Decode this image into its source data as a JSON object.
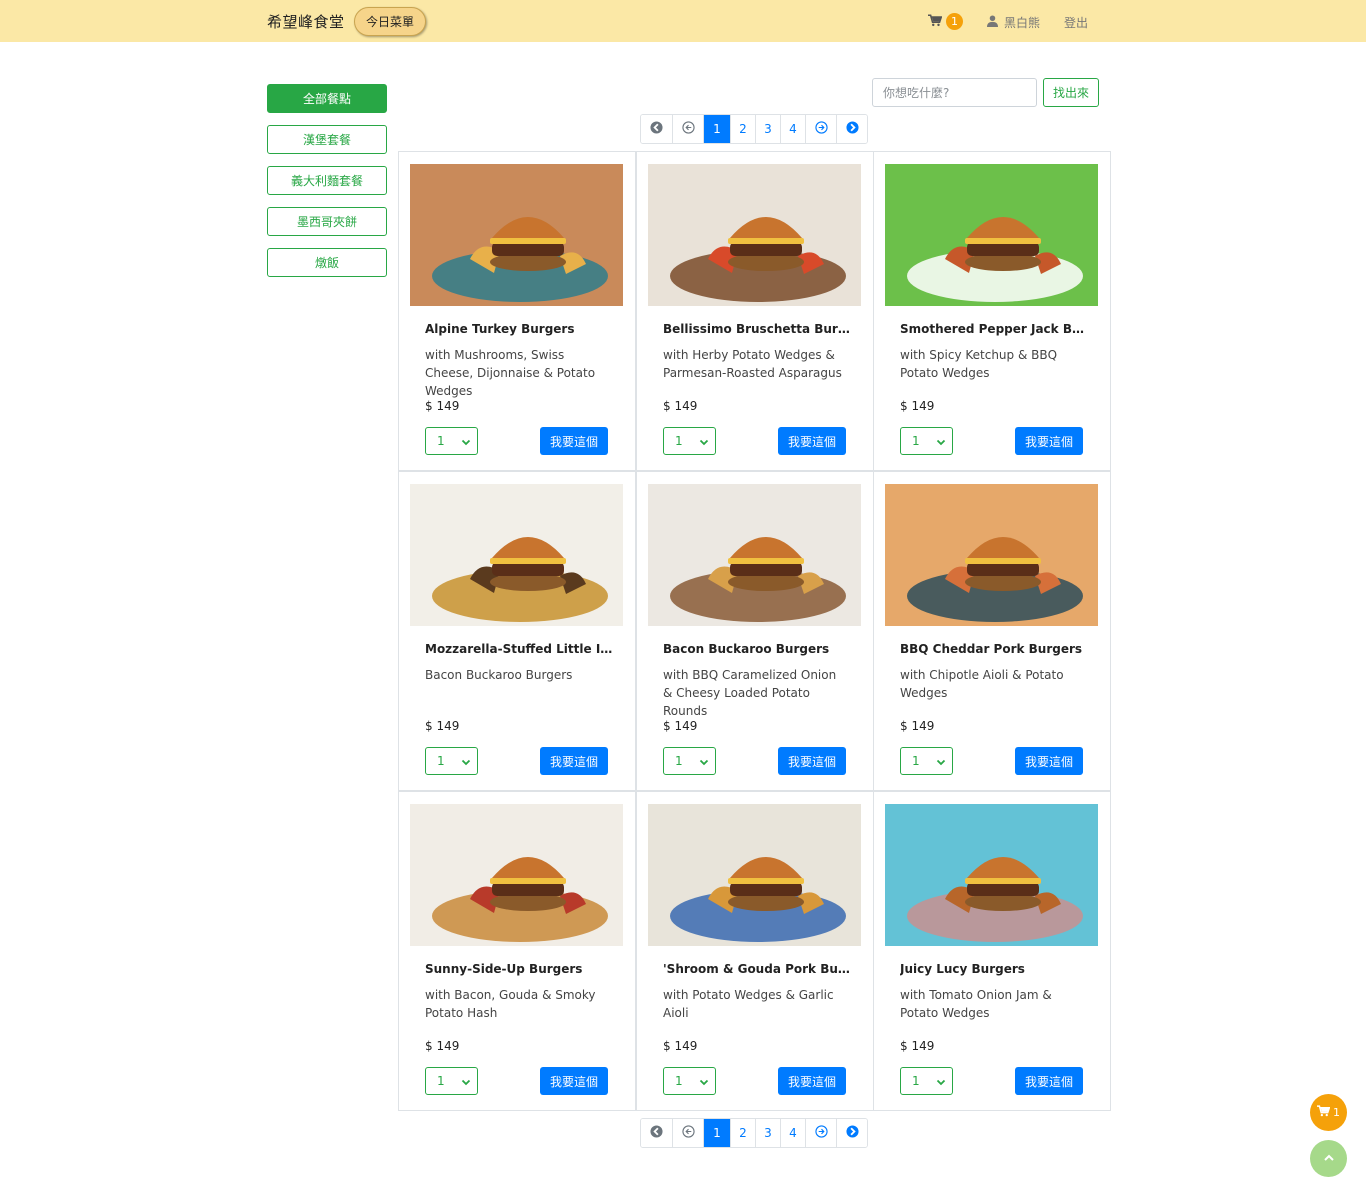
{
  "navbar": {
    "brand": "希望峰食堂",
    "today_menu": "今日菜單",
    "cart_icon": "cart-icon",
    "cart_count": "1",
    "user_icon": "user-icon",
    "user_name": "黑白熊",
    "logout": "登出"
  },
  "sidebar": {
    "items": [
      {
        "label": "全部餐點",
        "active": true
      },
      {
        "label": "漢堡套餐",
        "active": false
      },
      {
        "label": "義大利麵套餐",
        "active": false
      },
      {
        "label": "墨西哥夾餅",
        "active": false
      },
      {
        "label": "燉飯",
        "active": false
      }
    ]
  },
  "search": {
    "placeholder": "你想吃什麼?",
    "button": "找出來"
  },
  "pagination": {
    "first_icon": "first-page-icon",
    "prev_icon": "prev-page-icon",
    "pages": [
      "1",
      "2",
      "3",
      "4"
    ],
    "current": "1",
    "next_icon": "next-page-icon",
    "last_icon": "last-page-icon"
  },
  "colors": {
    "navbar_bg": "#fbe8a6",
    "green": "#28a745",
    "blue": "#007bff",
    "orange": "#f5a10a"
  },
  "products": [
    {
      "title": "Alpine Turkey Burgers",
      "desc": "with Mushrooms, Swiss Cheese, Dijonnaise & Potato Wedges",
      "price": "$ 149",
      "qty": "1",
      "button": "我要這個"
    },
    {
      "title": "Bellissimo Bruschetta Burgers",
      "desc": "with Herby Potato Wedges & Parmesan-Roasted Asparagus",
      "price": "$ 149",
      "qty": "1",
      "button": "我要這個"
    },
    {
      "title": "Smothered Pepper Jack Burgers",
      "desc": "with Spicy Ketchup & BBQ Potato Wedges",
      "price": "$ 149",
      "qty": "1",
      "button": "我要這個"
    },
    {
      "title": "Mozzarella-Stuffed Little Italy...",
      "desc": "Bacon Buckaroo Burgers",
      "price": "$ 149",
      "qty": "1",
      "button": "我要這個"
    },
    {
      "title": "Bacon Buckaroo Burgers",
      "desc": "with BBQ Caramelized Onion & Cheesy Loaded Potato Rounds",
      "price": "$ 149",
      "qty": "1",
      "button": "我要這個"
    },
    {
      "title": "BBQ Cheddar Pork Burgers",
      "desc": "with Chipotle Aioli & Potato Wedges",
      "price": "$ 149",
      "qty": "1",
      "button": "我要這個"
    },
    {
      "title": "Sunny-Side-Up Burgers",
      "desc": "with Bacon, Gouda & Smoky Potato Hash",
      "price": "$ 149",
      "qty": "1",
      "button": "我要這個"
    },
    {
      "title": "'Shroom & Gouda Pork Burgers",
      "desc": "with Potato Wedges & Garlic Aioli",
      "price": "$ 149",
      "qty": "1",
      "button": "我要這個"
    },
    {
      "title": "Juicy Lucy Burgers",
      "desc": "with Tomato Onion Jam & Potato Wedges",
      "price": "$ 149",
      "qty": "1",
      "button": "我要這個"
    }
  ],
  "floating": {
    "cart_icon": "cart-icon",
    "cart_count": "1",
    "top_icon": "chevron-up-icon"
  }
}
